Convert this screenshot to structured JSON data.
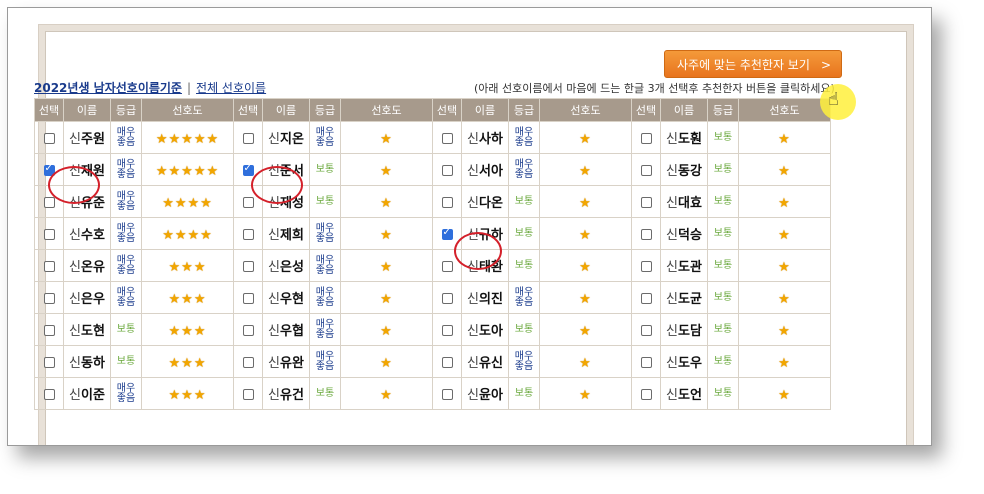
{
  "header": {
    "link_2022": "2022년생 남자선호이름기준",
    "separator": "|",
    "link_all": "전체 선호이름",
    "notice": "(아래 선호이름에서 마음에 드는 한글 3개 선택후 추천한자 버튼을 클릭하세요)",
    "recommend_button": "사주에 맞는 추천한자 보기",
    "recommend_arrow": ">"
  },
  "table_headers": [
    "선택",
    "이름",
    "등급",
    "선호도"
  ],
  "columns": [
    {
      "rows": [
        {
          "sur": "신",
          "given": "주원",
          "grade": "매우 좋음",
          "stars": "★★★★★",
          "checked": false
        },
        {
          "sur": "신",
          "given": "재원",
          "grade": "매우 좋음",
          "stars": "★★★★★",
          "checked": true
        },
        {
          "sur": "신",
          "given": "유준",
          "grade": "매우 좋음",
          "stars": "★★★★",
          "checked": false
        },
        {
          "sur": "신",
          "given": "수호",
          "grade": "매우 좋음",
          "stars": "★★★★",
          "checked": false
        },
        {
          "sur": "신",
          "given": "온유",
          "grade": "매우 좋음",
          "stars": "★★★",
          "checked": false
        },
        {
          "sur": "신",
          "given": "은우",
          "grade": "매우 좋음",
          "stars": "★★★",
          "checked": false
        },
        {
          "sur": "신",
          "given": "도현",
          "grade": "보통",
          "stars": "★★★",
          "checked": false
        },
        {
          "sur": "신",
          "given": "동하",
          "grade": "보통",
          "stars": "★★★",
          "checked": false
        },
        {
          "sur": "신",
          "given": "이준",
          "grade": "매우 좋음",
          "stars": "★★★",
          "checked": false
        }
      ]
    },
    {
      "rows": [
        {
          "sur": "신",
          "given": "지온",
          "grade": "매우 좋음",
          "stars": "★",
          "checked": false
        },
        {
          "sur": "신",
          "given": "준서",
          "grade": "보통",
          "stars": "★",
          "checked": true
        },
        {
          "sur": "신",
          "given": "재성",
          "grade": "보통",
          "stars": "★",
          "checked": false
        },
        {
          "sur": "신",
          "given": "제희",
          "grade": "매우 좋음",
          "stars": "★",
          "checked": false
        },
        {
          "sur": "신",
          "given": "은성",
          "grade": "매우 좋음",
          "stars": "★",
          "checked": false
        },
        {
          "sur": "신",
          "given": "우현",
          "grade": "매우 좋음",
          "stars": "★",
          "checked": false
        },
        {
          "sur": "신",
          "given": "우협",
          "grade": "매우 좋음",
          "stars": "★",
          "checked": false
        },
        {
          "sur": "신",
          "given": "유완",
          "grade": "매우 좋음",
          "stars": "★",
          "checked": false
        },
        {
          "sur": "신",
          "given": "유건",
          "grade": "보통",
          "stars": "★",
          "checked": false
        }
      ]
    },
    {
      "rows": [
        {
          "sur": "신",
          "given": "사하",
          "grade": "매우 좋음",
          "stars": "★",
          "checked": false
        },
        {
          "sur": "신",
          "given": "서아",
          "grade": "매우 좋음",
          "stars": "★",
          "checked": false
        },
        {
          "sur": "신",
          "given": "다온",
          "grade": "보통",
          "stars": "★",
          "checked": false
        },
        {
          "sur": "신",
          "given": "규하",
          "grade": "보통",
          "stars": "★",
          "checked": true
        },
        {
          "sur": "신",
          "given": "태환",
          "grade": "보통",
          "stars": "★",
          "checked": false
        },
        {
          "sur": "신",
          "given": "의진",
          "grade": "매우 좋음",
          "stars": "★",
          "checked": false
        },
        {
          "sur": "신",
          "given": "도아",
          "grade": "보통",
          "stars": "★",
          "checked": false
        },
        {
          "sur": "신",
          "given": "유신",
          "grade": "매우 좋음",
          "stars": "★",
          "checked": false
        },
        {
          "sur": "신",
          "given": "윤아",
          "grade": "보통",
          "stars": "★",
          "checked": false
        }
      ]
    },
    {
      "rows": [
        {
          "sur": "신",
          "given": "도훤",
          "grade": "보통",
          "stars": "★",
          "checked": false
        },
        {
          "sur": "신",
          "given": "동강",
          "grade": "보통",
          "stars": "★",
          "checked": false
        },
        {
          "sur": "신",
          "given": "대효",
          "grade": "보통",
          "stars": "★",
          "checked": false
        },
        {
          "sur": "신",
          "given": "덕승",
          "grade": "보통",
          "stars": "★",
          "checked": false
        },
        {
          "sur": "신",
          "given": "도관",
          "grade": "보통",
          "stars": "★",
          "checked": false
        },
        {
          "sur": "신",
          "given": "도균",
          "grade": "보통",
          "stars": "★",
          "checked": false
        },
        {
          "sur": "신",
          "given": "도담",
          "grade": "보통",
          "stars": "★",
          "checked": false
        },
        {
          "sur": "신",
          "given": "도우",
          "grade": "보통",
          "stars": "★",
          "checked": false
        },
        {
          "sur": "신",
          "given": "도언",
          "grade": "보통",
          "stars": "★",
          "checked": false
        }
      ]
    }
  ],
  "colors": {
    "header_bg": "#a79a8c",
    "button_orange": "#e8741e",
    "highlight_red": "#d4202a",
    "grade_good": "#1a3b8c",
    "grade_normal": "#6aa83c"
  },
  "icons": {
    "cursor": "hand-pointer-icon",
    "star": "star-icon",
    "chevron": "chevron-right-icon"
  }
}
